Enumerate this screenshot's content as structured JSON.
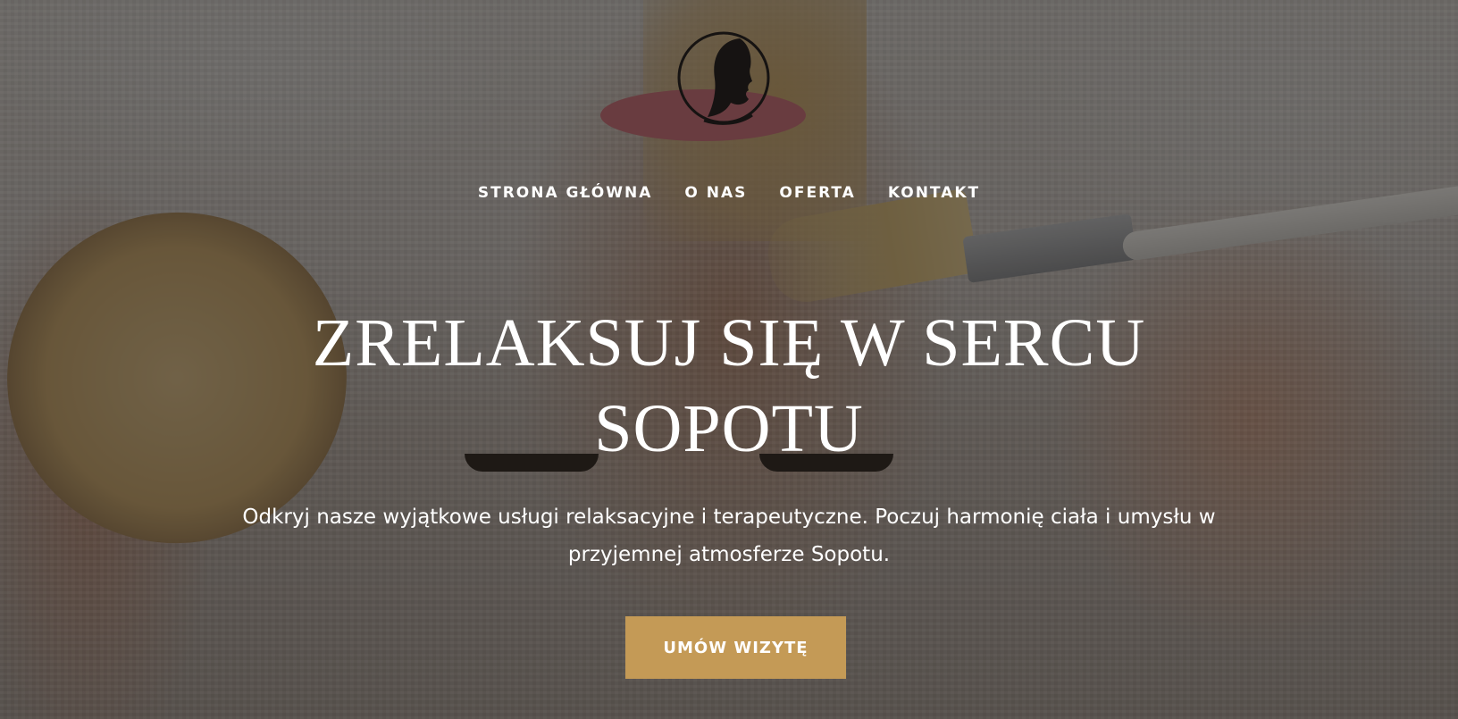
{
  "brand": {
    "logo_icon": "woman-silhouette-icon"
  },
  "nav": {
    "items": [
      {
        "label": "STRONA GŁÓWNA"
      },
      {
        "label": "O NAS"
      },
      {
        "label": "OFERTA"
      },
      {
        "label": "KONTAKT"
      }
    ]
  },
  "hero": {
    "headline_line1": "ZRELAKSUJ SIĘ W SERCU",
    "headline_line2": "SOPOTU",
    "subtitle_line1": "Odkryj nasze wyjątkowe usługi relaksacyjne i terapeutyczne. Poczuj harmonię ciała i umysłu w",
    "subtitle_line2": "przyjemnej atmosferze Sopotu.",
    "cta_label": "UMÓW WIZYTĘ"
  },
  "colors": {
    "accent": "#c49a56",
    "text": "#ffffff"
  }
}
